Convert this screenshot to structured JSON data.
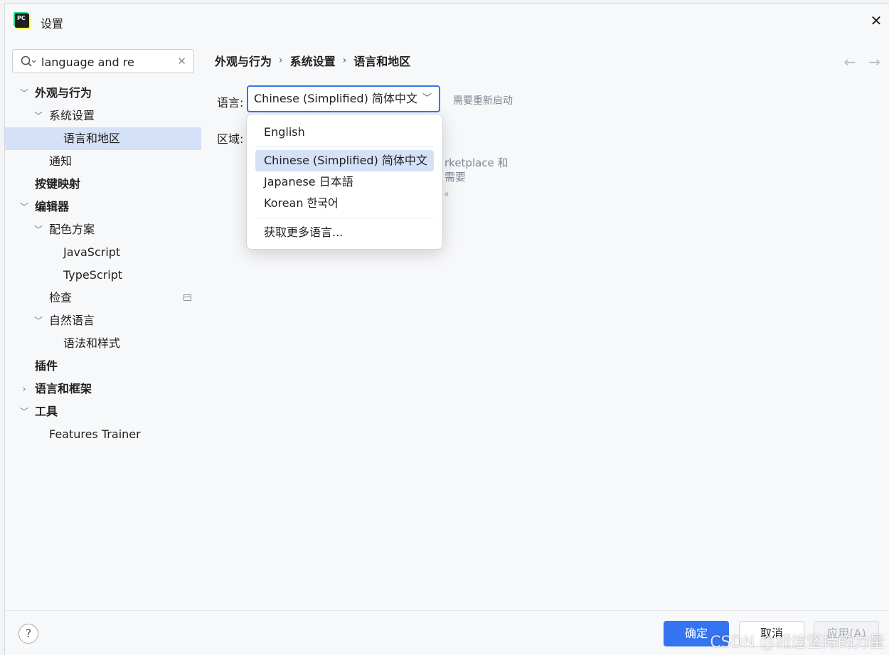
{
  "window": {
    "title": "设置",
    "app_icon_text": "PC"
  },
  "search": {
    "value": "language and re"
  },
  "sidebar": {
    "items": [
      {
        "label": "外观与行为",
        "bold": true,
        "chevron": "down"
      },
      {
        "label": "系统设置",
        "bold": false,
        "chevron": "down"
      },
      {
        "label": "语言和地区",
        "bold": false,
        "chevron": "",
        "selected": true
      },
      {
        "label": "通知",
        "bold": false,
        "chevron": ""
      },
      {
        "label": "按键映射",
        "bold": true,
        "chevron": ""
      },
      {
        "label": "编辑器",
        "bold": true,
        "chevron": "down"
      },
      {
        "label": "配色方案",
        "bold": false,
        "chevron": "down"
      },
      {
        "label": "JavaScript",
        "bold": false,
        "chevron": ""
      },
      {
        "label": "TypeScript",
        "bold": false,
        "chevron": ""
      },
      {
        "label": "检查",
        "bold": false,
        "chevron": "",
        "side_icon": "window-icon"
      },
      {
        "label": "自然语言",
        "bold": false,
        "chevron": "down"
      },
      {
        "label": "语法和样式",
        "bold": false,
        "chevron": ""
      },
      {
        "label": "插件",
        "bold": true,
        "chevron": ""
      },
      {
        "label": "语言和框架",
        "bold": true,
        "chevron": "right"
      },
      {
        "label": "工具",
        "bold": true,
        "chevron": "down"
      },
      {
        "label": "Features Trainer",
        "bold": false,
        "chevron": ""
      }
    ]
  },
  "breadcrumb": {
    "part1": "外观与行为",
    "part2": "系统设置",
    "part3": "语言和地区",
    "separator": "›"
  },
  "nav": {
    "back": "←",
    "forward": "→"
  },
  "language": {
    "label": "语言:",
    "selected": "Chinese (Simplified) 简体中文",
    "hint": "需要重新启动"
  },
  "region": {
    "label": "区域:"
  },
  "behind_text": {
    "line1": "rketplace 和",
    "line2": "需要",
    "line3": "。"
  },
  "dropdown": {
    "options": [
      {
        "label": "English"
      },
      {
        "label": "Chinese (Simplified) 简体中文",
        "active": true
      },
      {
        "label": "Japanese 日本語"
      },
      {
        "label": "Korean 한국어"
      },
      {
        "label": "获取更多语言..."
      }
    ]
  },
  "footer": {
    "help": "?",
    "ok": "确定",
    "cancel": "取消",
    "apply": "应用(A)"
  },
  "watermark": "CSDN @相信坚持的力量",
  "colors": {
    "accent": "#3574f0",
    "selection": "#d5e1f7"
  }
}
